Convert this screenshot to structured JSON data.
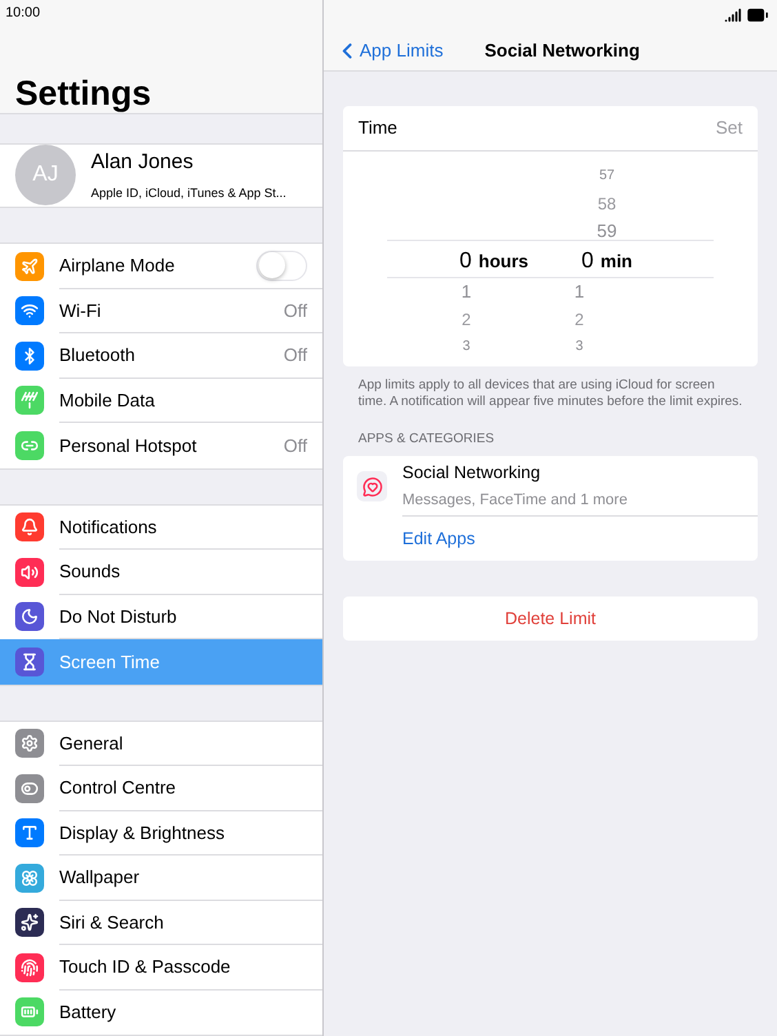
{
  "status_bar": {
    "time": "10:00"
  },
  "sidebar": {
    "title": "Settings",
    "profile": {
      "initials": "AJ",
      "name": "Alan Jones",
      "subtitle": "Apple ID, iCloud, iTunes & App St..."
    },
    "groups": [
      {
        "items": [
          {
            "label": "Airplane Mode",
            "color": "#ff9500",
            "kind": "toggle",
            "on": false,
            "selected": false
          },
          {
            "label": "Wi-Fi",
            "color": "#007aff",
            "kind": "value",
            "value": "Off",
            "selected": false
          },
          {
            "label": "Bluetooth",
            "color": "#007aff",
            "kind": "value",
            "value": "Off",
            "selected": false
          },
          {
            "label": "Mobile Data",
            "color": "#4cd964",
            "kind": "plain",
            "selected": false
          },
          {
            "label": "Personal Hotspot",
            "color": "#4cd964",
            "kind": "value",
            "value": "Off",
            "selected": false
          }
        ]
      },
      {
        "items": [
          {
            "label": "Notifications",
            "color": "#ff3b30",
            "kind": "plain",
            "selected": false
          },
          {
            "label": "Sounds",
            "color": "#ff2d55",
            "kind": "plain",
            "selected": false
          },
          {
            "label": "Do Not Disturb",
            "color": "#5856d6",
            "kind": "plain",
            "selected": false
          },
          {
            "label": "Screen Time",
            "color": "#5856d6",
            "kind": "plain",
            "selected": true
          }
        ]
      },
      {
        "items": [
          {
            "label": "General",
            "color": "#8e8e93",
            "kind": "plain",
            "selected": false
          },
          {
            "label": "Control Centre",
            "color": "#8e8e93",
            "kind": "plain",
            "selected": false
          },
          {
            "label": "Display & Brightness",
            "color": "#007aff",
            "kind": "plain",
            "selected": false
          },
          {
            "label": "Wallpaper",
            "color": "#34aadc",
            "kind": "plain",
            "selected": false
          },
          {
            "label": "Siri & Search",
            "color": "#2c2c54",
            "kind": "plain",
            "selected": false
          },
          {
            "label": "Touch ID & Passcode",
            "color": "#ff2d55",
            "kind": "plain",
            "selected": false
          },
          {
            "label": "Battery",
            "color": "#4cd964",
            "kind": "plain",
            "selected": false
          }
        ]
      }
    ]
  },
  "detail": {
    "back": "App Limits",
    "title": "Social Networking",
    "time_card": {
      "label": "Time",
      "action": "Set",
      "picker": {
        "hours_value": "0",
        "hours_unit": "hours",
        "hours_below": [
          "1",
          "2",
          "3"
        ],
        "min_above": [
          "57",
          "58",
          "59"
        ],
        "min_value": "0",
        "min_unit": "min",
        "min_below": [
          "1",
          "2",
          "3"
        ]
      }
    },
    "footnote": "App limits apply to all devices that are using iCloud for screen time. A notification will appear five minutes before the limit expires.",
    "section_header": "APPS & CATEGORIES",
    "category": {
      "title": "Social Networking",
      "subtitle": "Messages, FaceTime and 1 more"
    },
    "edit_apps": "Edit Apps",
    "delete": "Delete Limit"
  }
}
